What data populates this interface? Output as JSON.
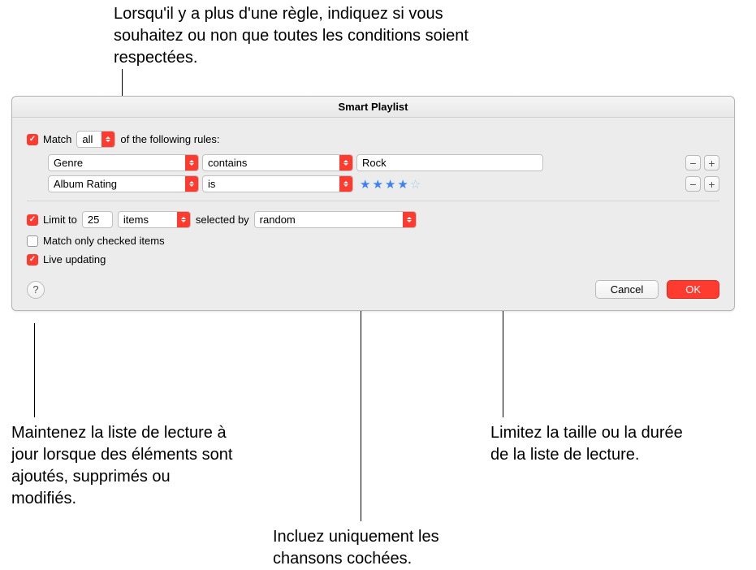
{
  "annotations": {
    "top": "Lorsqu'il y a plus d'une règle, indiquez si vous souhaitez ou non que toutes les conditions soient respectées.",
    "left": "Maintenez la liste de lecture à jour lorsque des éléments sont ajoutés, supprimés ou modifiés.",
    "center": "Incluez uniquement les chansons cochées.",
    "right": "Limitez la taille ou la durée de la liste de lecture."
  },
  "dialog": {
    "title": "Smart Playlist",
    "match": {
      "label": "Match",
      "mode": "all",
      "suffix": "of the following rules:"
    },
    "rules": [
      {
        "field": "Genre",
        "op": "contains",
        "value": "Rock",
        "type": "text"
      },
      {
        "field": "Album Rating",
        "op": "is",
        "stars_filled": 4,
        "stars_total": 5,
        "type": "stars"
      }
    ],
    "limit": {
      "label": "Limit to",
      "value": "25",
      "unit": "items",
      "selected_by_label": "selected by",
      "method": "random"
    },
    "match_checked_label": "Match only checked items",
    "live_updating_label": "Live updating",
    "buttons": {
      "help": "?",
      "cancel": "Cancel",
      "ok": "OK",
      "minus": "−",
      "plus": "+"
    }
  }
}
